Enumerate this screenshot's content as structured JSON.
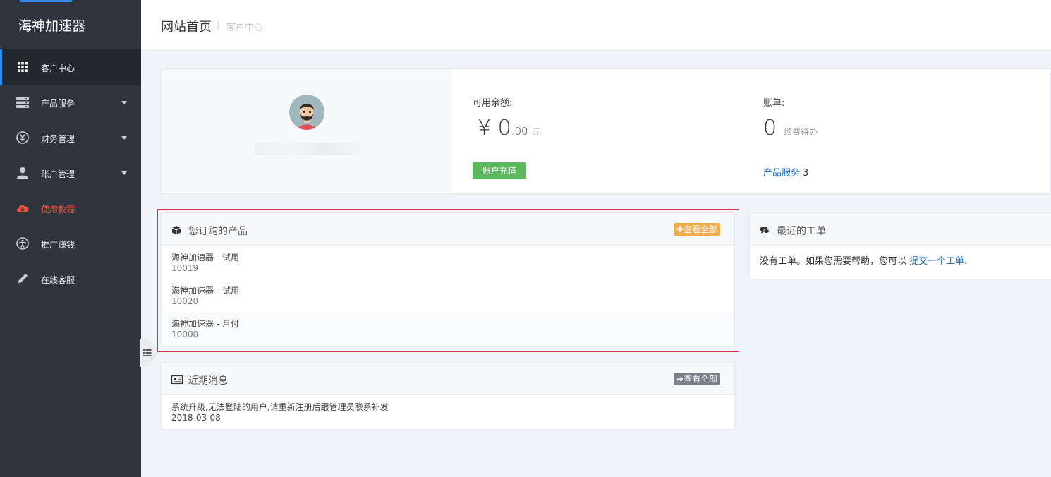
{
  "brand": "海神加速器",
  "sidebar": {
    "items": [
      {
        "label": "客户中心",
        "icon": "grid-icon",
        "active": true
      },
      {
        "label": "产品服务",
        "icon": "server-icon"
      },
      {
        "label": "财务管理",
        "icon": "yen-icon"
      },
      {
        "label": "账户管理",
        "icon": "user-icon"
      },
      {
        "label": "使用教程",
        "icon": "cloud-download-icon",
        "highlight": true
      },
      {
        "label": "推广赚钱",
        "icon": "accessibility-icon"
      },
      {
        "label": "在线客服",
        "icon": "pencil-icon"
      }
    ]
  },
  "header": {
    "title": "网站首页",
    "separator": "|",
    "crumb": "客户中心"
  },
  "profile": {
    "balance_label": "可用余额:",
    "currency": "¥",
    "balance_int": "0",
    "balance_dec": ".00",
    "balance_unit": "元",
    "recharge_button": "账户充值",
    "bill_label": "账单:",
    "bill_count": "0",
    "bill_note": "续费待办",
    "services_link": "产品服务",
    "services_count": "3"
  },
  "products_panel": {
    "title": "您订购的产品",
    "view_all": "查看全部",
    "rows": [
      {
        "name": "海神加速器 - 试用",
        "id": "10019"
      },
      {
        "name": "海神加速器 - 试用",
        "id": "10020"
      },
      {
        "name": "海神加速器 - 月付",
        "id": "10000"
      }
    ]
  },
  "news_panel": {
    "title": "近期消息",
    "view_all": "查看全部",
    "items": [
      {
        "text": "系统升级,无法登陆的用户,请重新注册后跟管理员联系补发",
        "date": "2018-03-08"
      }
    ]
  },
  "tickets_panel": {
    "title": "最近的工单",
    "empty_text": "没有工单。如果您需要帮助，您可以",
    "link": "提交一个工单",
    "suffix": "."
  },
  "colors": {
    "accent": "#2d8cf0",
    "sidebar": "#2f353f",
    "green": "#5cb85c",
    "orange": "#f0ad4e",
    "highlight": "#e8533e"
  }
}
